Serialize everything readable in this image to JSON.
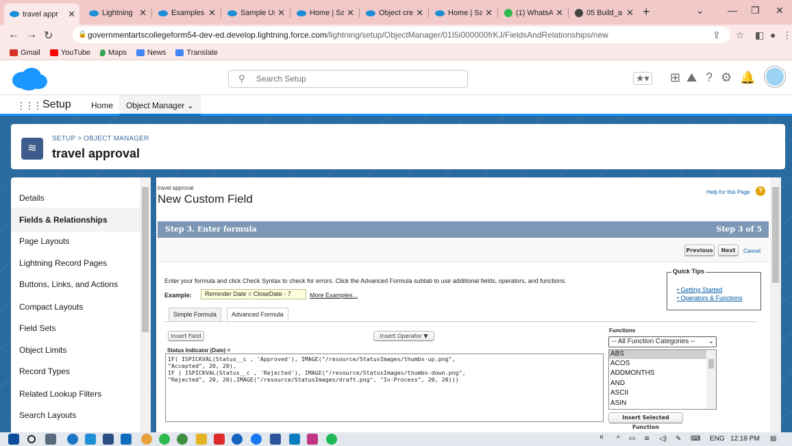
{
  "browser": {
    "tabs": [
      {
        "label": "travel appr",
        "active": true
      },
      {
        "label": "Lightning"
      },
      {
        "label": "Examples"
      },
      {
        "label": "Sample Us"
      },
      {
        "label": "Home | Sal"
      },
      {
        "label": "Object cre"
      },
      {
        "label": "Home | Sa"
      },
      {
        "label": "(1) WhatsA"
      },
      {
        "label": "05 Build_a"
      }
    ],
    "new_tab": "+",
    "url_host": "governmentartscollegeform54-dev-ed.develop.lightning.force.com",
    "url_path": "/lightning/setup/ObjectManager/01I5i000000frKJ/FieldsAndRelationships/new"
  },
  "bookmarks": [
    "Gmail",
    "YouTube",
    "Maps",
    "News",
    "Translate"
  ],
  "header": {
    "search_placeholder": "Search Setup"
  },
  "appnav": {
    "app_name": "Setup",
    "home": "Home",
    "object_manager": "Object Manager"
  },
  "object": {
    "breadcrumb": "SETUP > OBJECT MANAGER",
    "title": "travel approval"
  },
  "sidebar": {
    "items": [
      "Details",
      "Fields & Relationships",
      "Page Layouts",
      "Lightning Record Pages",
      "Buttons, Links, and Actions",
      "Compact Layouts",
      "Field Sets",
      "Object Limits",
      "Record Types",
      "Related Lookup Filters",
      "Search Layouts"
    ]
  },
  "main": {
    "crumb": "travel approval",
    "page_title": "New Custom Field",
    "help_link": "Help for this Page",
    "step_title": "Step 3. Enter formula",
    "step_count": "Step 3 of 5",
    "previous": "Previous",
    "next": "Next",
    "cancel": "Cancel",
    "instruction": "Enter your formula and click Check Syntax to check for errors. Click the Advanced Formula subtab to use additional fields, operators, and functions.",
    "example_label": "Example:",
    "example_value": "Reminder Date = CloseDate - 7",
    "more_examples": "More Examples...",
    "quick_tips_title": "Quick Tips",
    "quick_tips": [
      "Getting Started",
      "Operators & Functions"
    ],
    "tab_simple": "Simple Formula",
    "tab_advanced": "Advanced Formula",
    "insert_field": "Insert Field",
    "insert_operator": "Insert Operator",
    "field_label": "Status Indicator (Date) =",
    "formula": "IF( ISPICKVAL(Status__c , 'Approved'), IMAGE(\"/resource/StatusImages/thumbs-up.png\",\n\"Accepted\", 20, 20),\nIF ( ISPICKVAL(Status__c , 'Rejected'), IMAGE(\"/resource/StatusImages/thumbs-down.png\",\n\"Rejected\", 20, 20),IMAGE(\"/resource/StatusImages/draft.png\", \"In-Process\", 20, 20)))",
    "functions_title": "Functions",
    "functions_category": "-- All Function Categories --",
    "functions": [
      "ABS",
      "ACOS",
      "ADDMONTHS",
      "AND",
      "ASCII",
      "ASIN"
    ],
    "insert_function": "Insert Selected Function"
  },
  "taskbar": {
    "language": "ENG",
    "time": "12:18 PM"
  },
  "colors": {
    "brand_blue": "#1b96ff",
    "step_bar": "#7c98b6",
    "link": "#015ba7"
  }
}
